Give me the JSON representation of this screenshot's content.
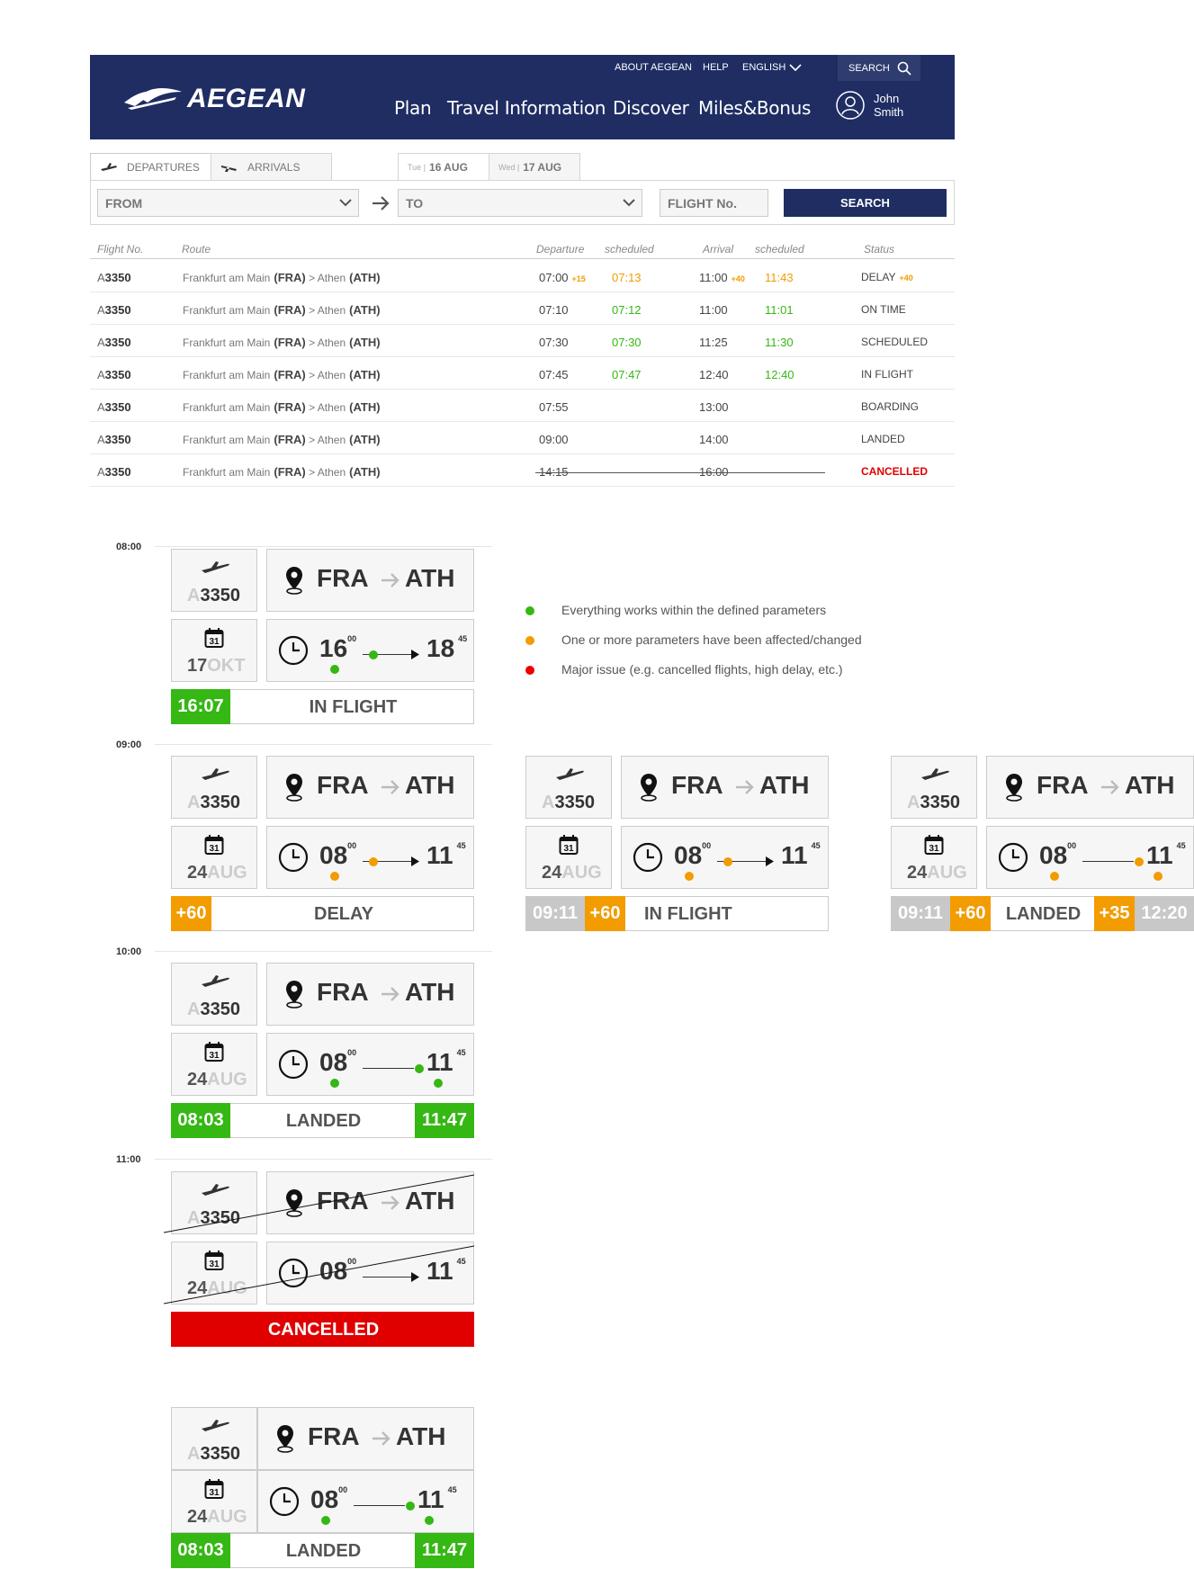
{
  "header": {
    "brand": "AEGEAN",
    "util_links": [
      "ABOUT AEGEAN",
      "HELP",
      "ENGLISH"
    ],
    "search_label": "SEARCH",
    "nav": [
      "Plan",
      "Travel Information",
      "Discover",
      "Miles&Bonus"
    ],
    "user": {
      "first": "John",
      "last": "Smith"
    }
  },
  "tabs": {
    "departures": "DEPARTURES",
    "arrivals": "ARRIVALS"
  },
  "dates": [
    {
      "dow": "Tue |",
      "date": "16 AUG"
    },
    {
      "dow": "Wed |",
      "date": "17 AUG"
    }
  ],
  "filter": {
    "from": "FROM",
    "to": "TO",
    "flight_no": "FLIGHT No.",
    "search": "SEARCH"
  },
  "table": {
    "headers": {
      "flight": "Flight No.",
      "route": "Route",
      "departure": "Departure",
      "dep_sched": "scheduled",
      "arrival": "Arrival",
      "arr_sched": "scheduled",
      "status": "Status"
    },
    "rows": [
      {
        "pre": "A",
        "num": "3350",
        "from_city": "Frankfurt am Main",
        "from": "(FRA)",
        "sep": " > ",
        "to_city": "Athen",
        "to": "(ATH)",
        "dep": "07:00",
        "dep_delta": "+15",
        "dep_s": "07:13",
        "arr": "11:00",
        "arr_delta": "+40",
        "arr_s": "11:43",
        "status": "DELAY",
        "status_delta": "+40"
      },
      {
        "pre": "A",
        "num": "3350",
        "from_city": "Frankfurt am Main",
        "from": "(FRA)",
        "sep": " > ",
        "to_city": "Athen",
        "to": "(ATH)",
        "dep": "07:10",
        "dep_delta": "",
        "dep_s": "07:12",
        "arr": "11:00",
        "arr_delta": "",
        "arr_s": "11:01",
        "status": "ON TIME",
        "status_delta": ""
      },
      {
        "pre": "A",
        "num": "3350",
        "from_city": "Frankfurt am Main",
        "from": "(FRA)",
        "sep": " > ",
        "to_city": "Athen",
        "to": "(ATH)",
        "dep": "07:30",
        "dep_delta": "",
        "dep_s": "07:30",
        "arr": "11:25",
        "arr_delta": "",
        "arr_s": "11:30",
        "status": "SCHEDULED",
        "status_delta": ""
      },
      {
        "pre": "A",
        "num": "3350",
        "from_city": "Frankfurt am Main",
        "from": "(FRA)",
        "sep": " > ",
        "to_city": "Athen",
        "to": "(ATH)",
        "dep": "07:45",
        "dep_delta": "",
        "dep_s": "07:47",
        "arr": "12:40",
        "arr_delta": "",
        "arr_s": "12:40",
        "status": "IN FLIGHT",
        "status_delta": ""
      },
      {
        "pre": "A",
        "num": "3350",
        "from_city": "Frankfurt am Main",
        "from": "(FRA)",
        "sep": " > ",
        "to_city": "Athen",
        "to": "(ATH)",
        "dep": "07:55",
        "dep_delta": "",
        "dep_s": "",
        "arr": "13:00",
        "arr_delta": "",
        "arr_s": "",
        "status": "BOARDING",
        "status_delta": ""
      },
      {
        "pre": "A",
        "num": "3350",
        "from_city": "Frankfurt am Main",
        "from": "(FRA)",
        "sep": " > ",
        "to_city": "Athen",
        "to": "(ATH)",
        "dep": "09:00",
        "dep_delta": "",
        "dep_s": "",
        "arr": "14:00",
        "arr_delta": "",
        "arr_s": "",
        "status": "LANDED",
        "status_delta": ""
      },
      {
        "pre": "A",
        "num": "3350",
        "from_city": "Frankfurt am Main",
        "from": "(FRA)",
        "sep": " > ",
        "to_city": "Athen",
        "to": "(ATH)",
        "dep": "14:15",
        "dep_delta": "",
        "dep_s": "",
        "arr": "16:00",
        "arr_delta": "",
        "arr_s": "",
        "status": "CANCELLED",
        "status_delta": ""
      }
    ]
  },
  "colors": {
    "navy": "#1f2d63",
    "green": "#35b714",
    "orange": "#f29c00",
    "red": "#e00000",
    "grey": "#c8c8c8"
  },
  "timeline": [
    "08:00",
    "09:00",
    "10:00",
    "11:00"
  ],
  "legend": [
    {
      "color": "green",
      "text": "Everything works within the defined parameters"
    },
    {
      "color": "orange",
      "text": "One or more parameters have been affected/changed"
    },
    {
      "color": "red",
      "text": "Major issue (e.g. cancelled flights, high delay, etc.)"
    }
  ],
  "cards": [
    {
      "pre": "A",
      "num": "3350",
      "from": "FRA",
      "to": "ATH",
      "cal": "31",
      "day": "17",
      "mon": "OKT",
      "dep_h": "16",
      "dep_m": "00",
      "arr_h": "18",
      "arr_m": "45",
      "status": "IN FLIGHT",
      "left_chips": [
        "16:07"
      ],
      "right_chips": []
    },
    {
      "pre": "A",
      "num": "3350",
      "from": "FRA",
      "to": "ATH",
      "cal": "31",
      "day": "24",
      "mon": "AUG",
      "dep_h": "08",
      "dep_m": "00",
      "arr_h": "11",
      "arr_m": "45",
      "status": "DELAY",
      "left_chips": [
        "+60"
      ],
      "right_chips": []
    },
    {
      "pre": "A",
      "num": "3350",
      "from": "FRA",
      "to": "ATH",
      "cal": "31",
      "day": "24",
      "mon": "AUG",
      "dep_h": "08",
      "dep_m": "00",
      "arr_h": "11",
      "arr_m": "45",
      "status": "IN FLIGHT",
      "left_chips": [
        "09:11",
        "+60"
      ],
      "right_chips": []
    },
    {
      "pre": "A",
      "num": "3350",
      "from": "FRA",
      "to": "ATH",
      "cal": "31",
      "day": "24",
      "mon": "AUG",
      "dep_h": "08",
      "dep_m": "00",
      "arr_h": "11",
      "arr_m": "45",
      "status": "LANDED",
      "left_chips": [
        "09:11",
        "+60"
      ],
      "right_chips": [
        "+35",
        "12:20"
      ]
    },
    {
      "pre": "A",
      "num": "3350",
      "from": "FRA",
      "to": "ATH",
      "cal": "31",
      "day": "24",
      "mon": "AUG",
      "dep_h": "08",
      "dep_m": "00",
      "arr_h": "11",
      "arr_m": "45",
      "status": "LANDED",
      "left_chips": [
        "08:03"
      ],
      "right_chips": [
        "11:47"
      ]
    },
    {
      "pre": "A",
      "num": "3350",
      "from": "FRA",
      "to": "ATH",
      "cal": "31",
      "day": "24",
      "mon": "AUG",
      "dep_h": "08",
      "dep_m": "00",
      "arr_h": "11",
      "arr_m": "45",
      "status": "CANCELLED",
      "left_chips": [],
      "right_chips": []
    },
    {
      "pre": "A",
      "num": "3350",
      "from": "FRA",
      "to": "ATH",
      "cal": "31",
      "day": "24",
      "mon": "AUG",
      "dep_h": "08",
      "dep_m": "00",
      "arr_h": "11",
      "arr_m": "45",
      "status": "LANDED",
      "left_chips": [
        "08:03"
      ],
      "right_chips": [
        "11:47"
      ]
    }
  ]
}
